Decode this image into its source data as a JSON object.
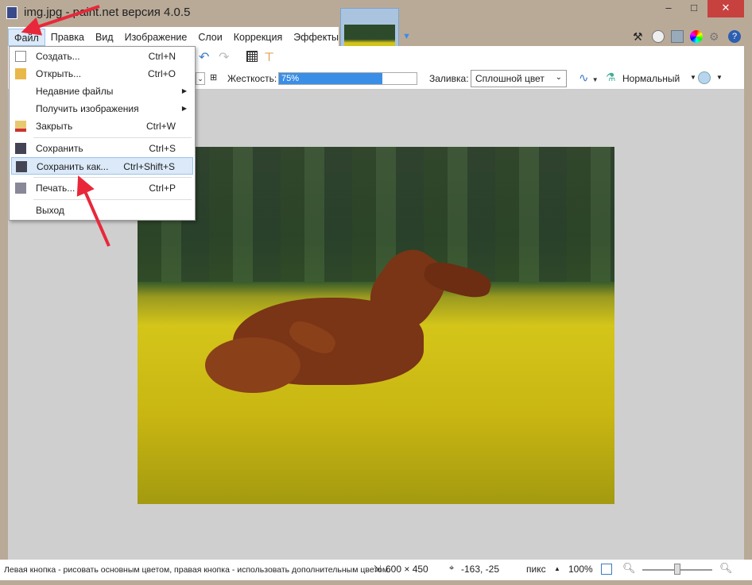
{
  "window": {
    "title": "img.jpg - paint.net версия 4.0.5",
    "minimize": "–",
    "maximize": "□",
    "close": "✕"
  },
  "menubar": [
    "Файл",
    "Правка",
    "Вид",
    "Изображение",
    "Слои",
    "Коррекция",
    "Эффекты"
  ],
  "file_menu": [
    {
      "label": "Создать...",
      "shortcut": "Ctrl+N",
      "icon": "new-file-icon"
    },
    {
      "label": "Открыть...",
      "shortcut": "Ctrl+O",
      "icon": "open-icon"
    },
    {
      "label": "Недавние файлы",
      "submenu": true
    },
    {
      "label": "Получить изображения",
      "submenu": true
    },
    {
      "label": "Закрыть",
      "shortcut": "Ctrl+W",
      "icon": "close-file-icon"
    },
    {
      "label": "Сохранить",
      "shortcut": "Ctrl+S",
      "icon": "save-icon"
    },
    {
      "label": "Сохранить как...",
      "shortcut": "Ctrl+Shift+S",
      "icon": "save-as-icon",
      "highlighted": true
    },
    {
      "label": "Печать...",
      "shortcut": "Ctrl+P",
      "icon": "print-icon"
    },
    {
      "label": "Выход"
    }
  ],
  "toolbar": {
    "hardness_label": "Жесткость:",
    "hardness_value": "75%",
    "hardness_percent": 75,
    "fill_label": "Заливка:",
    "fill_value": "Сплошной цвет",
    "blend_value": "Нормальный"
  },
  "status": {
    "hint": "Левая кнопка - рисовать основным цветом, правая кнопка - использовать дополнительным цветом.",
    "size": "600 × 450",
    "cursor": "-163, -25",
    "units": "пикс",
    "zoom": "100%"
  },
  "colors": {
    "arrow": "#e8283a",
    "accent": "#3b8ee6",
    "close": "#c7413f"
  }
}
